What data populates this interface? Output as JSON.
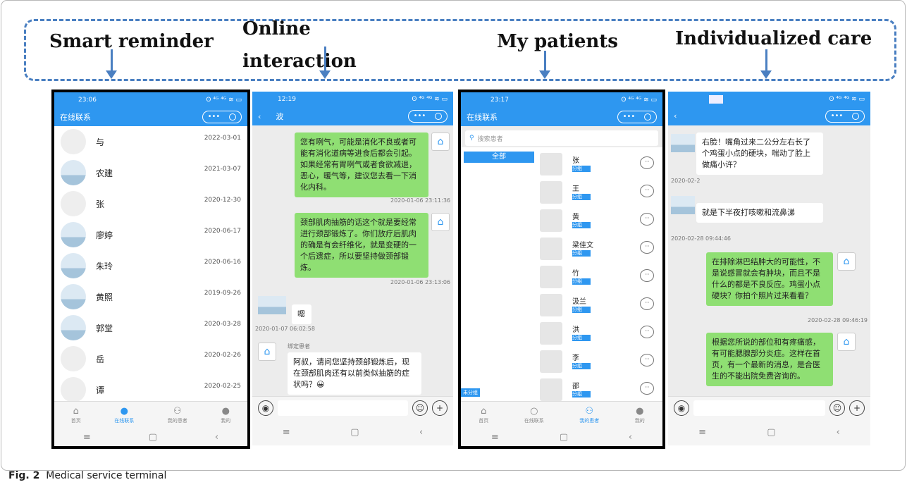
{
  "labels": {
    "smart": "Smart reminder",
    "online1": "Online",
    "online2": "interaction",
    "patients": "My patients",
    "care": "Individualized care"
  },
  "caption": {
    "fig": "Fig. 2",
    "text": "Medical service terminal"
  },
  "phone1": {
    "time": "23:06",
    "status": "ʘ ⁴ᴳ ⁴ᴳ ≋ ▭",
    "title": "在线联系",
    "contacts": [
      {
        "name": "与",
        "date": "2022-03-01"
      },
      {
        "name": "农建",
        "date": "2021-03-07"
      },
      {
        "name": "张",
        "date": "2020-12-30"
      },
      {
        "name": "廖婷",
        "date": "2020-06-17"
      },
      {
        "name": "朱玲",
        "date": "2020-06-16"
      },
      {
        "name": "黄照",
        "date": "2019-09-26"
      },
      {
        "name": "郭堂",
        "date": "2020-03-28"
      },
      {
        "name": "岳",
        "date": "2020-02-26"
      },
      {
        "name": "谭",
        "date": "2020-02-25"
      }
    ],
    "nav": [
      "首页",
      "在线联系",
      "我的患者",
      "我的"
    ]
  },
  "phone2": {
    "time": "12:19",
    "status": "ʘ ⁴ᴳ ⁴ᴳ ≋ ▭",
    "title": "波",
    "msg1": "您有咧气，可能是消化不良或者可能有消化道病等进食后都会引起。如果经常有胃咧气或者食欲减退，恶心，暖气等，建议您去看一下消化内科。",
    "ts1": "2020-01-06 23:11:36",
    "msg2": "颈部肌肉抽筋的话这个就是要经常进行颈部锻炼了。你们放疗后肌肉的确是有会纤维化，就是变硬的一个后遗症，所以要坚持做颈部锻炼。",
    "ts2": "2020-01-06 23:13:06",
    "msg3": "嗯",
    "ts3": "2020-01-07 06:02:58",
    "sender": "绑定患者",
    "msg4": "阿叔，请问您坚持颈部锻炼后，现在颈部肌肉还有以前类似抽筋的症状吗？😀"
  },
  "phone3": {
    "time": "23:17",
    "status": "ʘ ⁴ᴳ ⁴ᴳ ≋ ▭",
    "title": "在线联系",
    "search_placeholder": "搜索患者",
    "all": "全部",
    "tag": "分组",
    "patients": [
      "张",
      "王",
      "黄",
      "梁佳文",
      "竹",
      "汲兰",
      "洪",
      "李",
      "邵"
    ],
    "side_tag": "未分组",
    "nav": [
      "首页",
      "在线联系",
      "我的患者",
      "我的"
    ]
  },
  "phone4": {
    "status": "ʘ ⁴ᴳ ⁴ᴳ ≋ ▭",
    "msg1": "右脸！嘴角过来二公分左右长了个鸡蛋小点的硬块，喘动了脸上做痛小许？",
    "ts1": "2020-02-2",
    "msg2": "就是下半夜打咳嗽和流鼻涕",
    "ts2": "2020-02-28 09:44:46",
    "msg3": "在排除淋巴结肿大的可能性，不是说感冒就会有肿块，而且不是什么的都是不良反应。鸡蛋小点硬块？你拍个照片过来看看？",
    "ts3": "2020-02-28 09:46:19",
    "msg4": "根据您所说的部位和有疼痛感，有可能腮腺部分炎症。这样在首页，有一个最新的消息，是合医生的不能出院免费咨询的。"
  }
}
